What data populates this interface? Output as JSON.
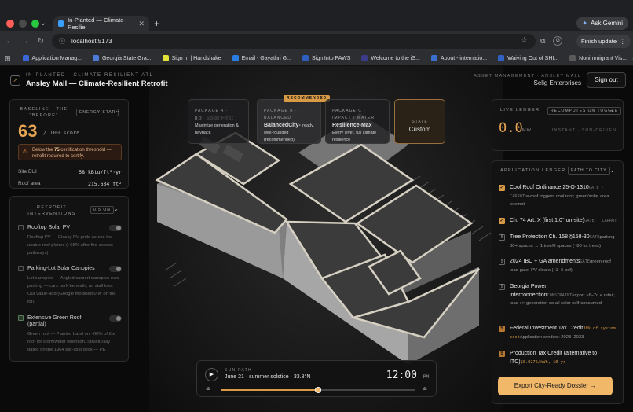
{
  "browser": {
    "tab_title": "In-Planted — Climate-Resilie",
    "url": "localhost:5173",
    "gemini_label": "Ask Gemini",
    "finish_update_label": "Finish update",
    "avatar_letter": "G",
    "bookmarks": [
      {
        "label": "Application Manag...",
        "color": "#3a66d6"
      },
      {
        "label": "Georgia State Gra...",
        "color": "#4c7bd9"
      },
      {
        "label": "Sign In | Handshake",
        "color": "#e2e23a"
      },
      {
        "label": "Email - Gayathri G...",
        "color": "#2a7de1"
      },
      {
        "label": "Sign Into PAWS",
        "color": "#2d5fbf"
      },
      {
        "label": "Welcome to the iS...",
        "color": "#3c3c8a"
      },
      {
        "label": "About - internatio...",
        "color": "#3a6fd0"
      },
      {
        "label": "Waiving Out of SHI...",
        "color": "#2f62c4"
      },
      {
        "label": "Nonimmigrant Vis...",
        "color": "#5a5a5a"
      }
    ]
  },
  "header": {
    "kicker": "IN-PLANTED · CLIMATE-RESILIENT ATL",
    "title": "Ansley Mall — Climate-Resilient Retrofit",
    "right_kicker": "ASSET MANAGEMENT · ANSLEY MALL",
    "company": "Selig Enterprises",
    "signout_label": "Sign out"
  },
  "baseline": {
    "kicker": "BASELINE · THE \"BEFORE\"",
    "badge": "ENERGY STAR",
    "score": "63",
    "score_of": "/ 100 score",
    "warning_a": "Below the ",
    "warning_b": "75",
    "warning_c": " certification threshold — retrofit required to certify.",
    "site_eui_label": "Site EUI",
    "site_eui_value": "58 kBtu/ft²·yr",
    "roof_area_label": "Roof area",
    "roof_area_value": "215,634 ft²"
  },
  "interventions": {
    "kicker": "RETROFIT INTERVENTIONS",
    "badge": "0/5 ON",
    "items": [
      {
        "title": "Rooftop Solar PV",
        "desc": "Rooftop PV — Glassy PV grids across the usable roof planes (~65% after fire-access pathways)."
      },
      {
        "title": "Parking-Lot Solar Canopies",
        "desc": "Lot canopies — Angled carport canopies over parking — cars park beneath, no stall loss. Our value-add (Google modeled 0 W on the lot)."
      },
      {
        "title": "Extensive Green Roof (partial)",
        "desc": "Green roof — Planted band on ~60% of the roof for stormwater retention. Structurally gated on the 1964 bar-joist deck — PE"
      }
    ]
  },
  "packages": [
    {
      "kicker_a": "PACKAGE A ·",
      "kicker_b": "ROI",
      "name": "Solar First",
      "desc": "Maximize generation & payback"
    },
    {
      "kicker_a": "PACKAGE B ·",
      "kicker_b": "BALANCED",
      "name": "Balanced",
      "name2": "City-",
      "desc": "ready, well-rounded (recommended)"
    },
    {
      "kicker_a": "PACKAGE C ·",
      "kicker_b": "IMPACT / WATER",
      "name": "Resilience-Max",
      "desc": "Every lever, full climate resilience"
    }
  ],
  "recommended_label": "RECOMMENDED",
  "custom": {
    "kicker": "STATE",
    "name": "Custom"
  },
  "live_ledger": {
    "kicker": "LIVE LEDGER",
    "badge": "RECOMPUTES ON TOGGLE",
    "value": "0.0",
    "unit": "MW",
    "right": "INSTANT · SUN-DRIVEN"
  },
  "app_ledger": {
    "kicker": "APPLICATION LEDGER",
    "badge": "PATH TO CITY",
    "items": [
      {
        "icon": "check",
        "title": "Cool Roof Ordinance 25-O-1310",
        "meta": "GATE · CARROT",
        "sub": "re-roof triggers cool roof; green/solar area exempt"
      },
      {
        "icon": "check",
        "title": "Ch. 74 Art. X (first 1.0° on-site)",
        "meta": "GATE · CARROT",
        "sub": ""
      },
      {
        "icon": "excl",
        "title": "Tree Protection Ch. 158 §158-30",
        "meta": "GATE",
        "sub": "parking 30+ spaces → 1 tree/8 spaces (~80 lot trees)"
      },
      {
        "icon": "excl",
        "title": "2024 IBC + GA amendments",
        "meta": "GATE",
        "sub": "green-roof load gate; PV clears (~3–5 psf)"
      },
      {
        "icon": "excl",
        "title": "Georgia Power interconnection",
        "meta": "CONSTRAINT",
        "sub": "export ~6–7c < retail; load >> generation so all solar self-consumed"
      },
      {
        "icon": "dollar",
        "title": "Federal Investment Tax Credit",
        "meta": "30% of system cost",
        "sub": "Application window: 2023–2033"
      },
      {
        "icon": "dollar",
        "title": "Production Tax Credit (alternative to ITC)",
        "meta": "$0.0275/kWh, 10 yr",
        "sub": ""
      }
    ],
    "export_label": "Export City-Ready Dossier →"
  },
  "sun_path": {
    "kicker": "SUN PATH",
    "date": "June 21 · summer solstice · 33.8°N",
    "time": "12:00",
    "ampm": "PM",
    "progress": 0.5
  }
}
